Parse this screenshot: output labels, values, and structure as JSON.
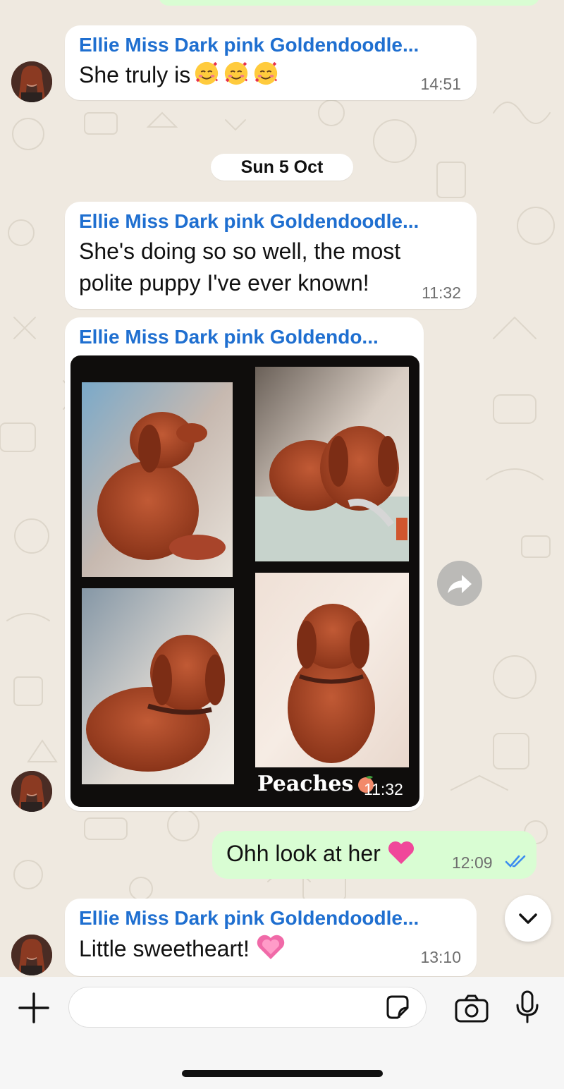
{
  "colors": {
    "sender_name": "#1f6fd0",
    "incoming_bubble": "#ffffff",
    "outgoing_bubble": "#d9fdd3",
    "read_ticks": "#3b8cf0",
    "wallpaper": "#efe9e0"
  },
  "messages": [
    {
      "sender": "Ellie  Miss Dark pink Goldendoodle...",
      "text": "She truly is",
      "emoji": [
        "smiling-face-with-hearts",
        "smiling-face-with-hearts",
        "smiling-face-with-hearts"
      ],
      "time": "14:51"
    },
    {
      "sender": "Ellie  Miss Dark pink Goldendoodle...",
      "text_lines": [
        "She's doing so so well, the most",
        "polite puppy I've ever known!"
      ],
      "time": "11:32"
    },
    {
      "sender": "Ellie  Miss Dark pink Goldendo...",
      "image_caption": "Peaches",
      "image_caption_emoji": "peach",
      "time": "11:32"
    },
    {
      "sender": "Ellie  Miss Dark pink Goldendoodle...",
      "text": "Little sweetheart!",
      "emoji": [
        "growing-heart"
      ],
      "time": "13:10"
    }
  ],
  "date_divider": "Sun 5 Oct",
  "outgoing": {
    "text": "Ohh look at her",
    "emoji": "pink-heart",
    "time": "12:09",
    "status": "read"
  },
  "composer": {
    "placeholder": "",
    "icons": [
      "plus-icon",
      "sticker-icon",
      "camera-icon",
      "microphone-icon"
    ]
  },
  "buttons": {
    "forward": "forward-arrow-icon",
    "scroll_down": "chevron-down-icon"
  }
}
